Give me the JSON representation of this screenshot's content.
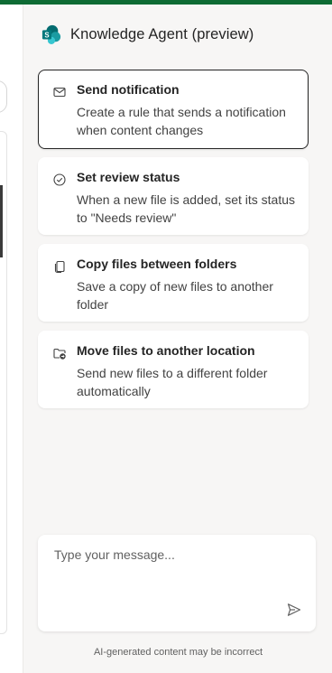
{
  "header": {
    "title": "Knowledge Agent (preview)",
    "logo_icon": "sharepoint-logo-icon"
  },
  "suggestions": [
    {
      "icon": "mail-icon",
      "title": "Send notification",
      "description": "Create a rule that sends a notification when content changes",
      "selected": true
    },
    {
      "icon": "checkmark-circle-icon",
      "title": "Set review status",
      "description": "When a new file is added, set its status to \"Needs review\"",
      "selected": false
    },
    {
      "icon": "copy-icon",
      "title": "Copy files between folders",
      "description": "Save a copy of new files to another folder",
      "selected": false
    },
    {
      "icon": "folder-move-icon",
      "title": "Move files to another location",
      "description": "Send new files to a different folder automatically",
      "selected": false
    }
  ],
  "composer": {
    "placeholder": "Type your message...",
    "value": "",
    "send_icon": "send-icon"
  },
  "footer": {
    "disclaimer": "AI-generated content may be incorrect"
  },
  "colors": {
    "accent_bar": "#0e6b34",
    "panel_bg": "#f7f6f5",
    "card_bg": "#ffffff",
    "selected_border": "#242424"
  }
}
